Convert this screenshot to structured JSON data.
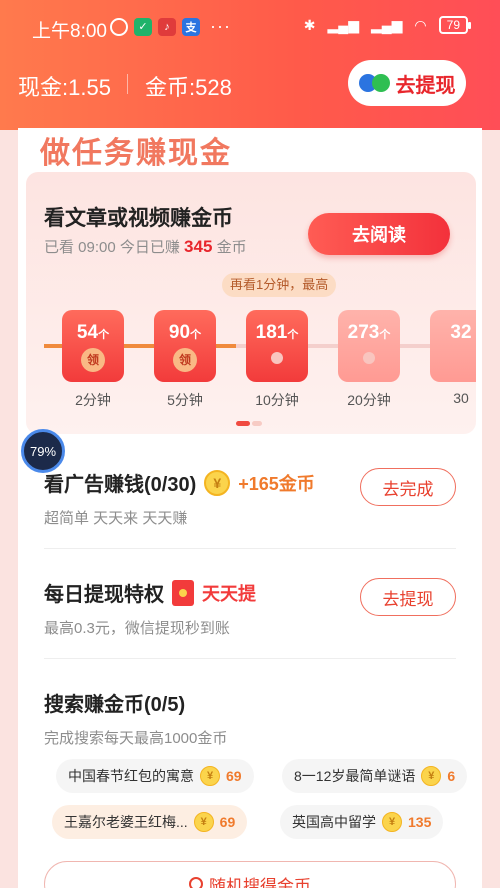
{
  "status_bar": {
    "time": "上午8:00",
    "icons_left": [
      "alarm-icon",
      "shield-icon",
      "listen-app-icon",
      "alipay-icon"
    ],
    "more": "···",
    "battery": "79"
  },
  "header": {
    "cash_label": "现金:1.55",
    "coins_label": "金币:528",
    "withdraw_button": "去提现"
  },
  "section_title": "做任务赚现金",
  "read_task": {
    "title": "看文章或视频赚金币",
    "sub_prefix": "已看 09:00 今日已赚",
    "earned": "345",
    "sub_suffix": "金币",
    "button": "去阅读",
    "tip": "再看1分钟，最高",
    "rewards": [
      {
        "amount": "54",
        "unit": "个",
        "badge": "领",
        "label": "2分钟",
        "state": "claimable"
      },
      {
        "amount": "90",
        "unit": "个",
        "badge": "领",
        "label": "5分钟",
        "state": "claimable"
      },
      {
        "amount": "181",
        "unit": "个",
        "badge": "",
        "label": "10分钟",
        "state": "current"
      },
      {
        "amount": "273",
        "unit": "个",
        "badge": "",
        "label": "20分钟",
        "state": "future"
      },
      {
        "amount": "32",
        "unit": "",
        "badge": "",
        "label": "30",
        "state": "future"
      }
    ]
  },
  "float_badge": "79%",
  "ad_task": {
    "title": "看广告赚钱(0/30)",
    "coin_symbol": "¥",
    "reward": "+165金币",
    "sub": "超简单 天天来 天天赚",
    "button": "去完成"
  },
  "withdraw_task": {
    "title": "每日提现特权",
    "tag": "天天提",
    "sub": "最高0.3元，微信提现秒到账",
    "button": "去提现"
  },
  "search_task": {
    "title": "搜索赚金币(0/5)",
    "sub": "完成搜索每天最高1000金币",
    "chips": [
      {
        "text": "中国春节红包的寓意",
        "coins": "69"
      },
      {
        "text": "8一12岁最简单谜语",
        "coins": "6"
      },
      {
        "text": "王嘉尔老婆王红梅...",
        "coins": "69"
      },
      {
        "text": "英国高中留学",
        "coins": "135"
      }
    ],
    "random_button": "随机搜得金币"
  }
}
